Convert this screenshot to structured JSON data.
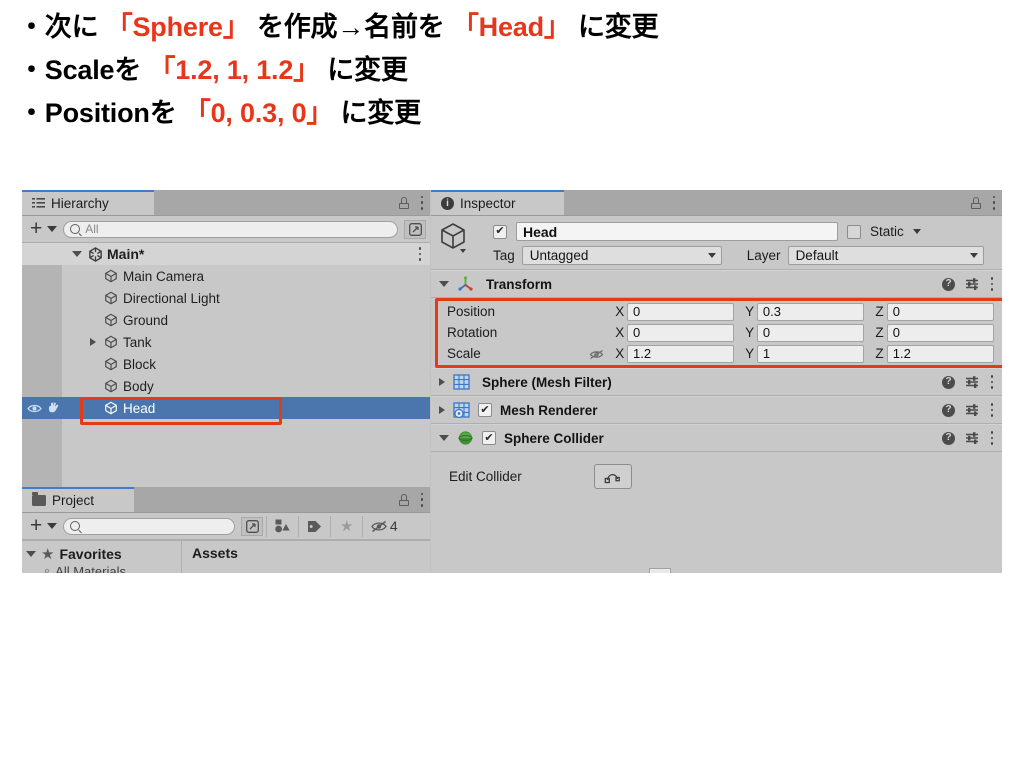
{
  "slide": {
    "bullets": [
      [
        {
          "t": "・次に ",
          "hl": false
        },
        {
          "t": "「Sphere」",
          "hl": true
        },
        {
          "t": " を作成→名前を ",
          "hl": false
        },
        {
          "t": "「Head」",
          "hl": true
        },
        {
          "t": " に変更",
          "hl": false
        }
      ],
      [
        {
          "t": "・Scaleを ",
          "hl": false
        },
        {
          "t": "「1.2, 1, 1.2」",
          "hl": true
        },
        {
          "t": " に変更",
          "hl": false
        }
      ],
      [
        {
          "t": "・Positionを ",
          "hl": false
        },
        {
          "t": "「0, 0.3, 0」",
          "hl": true
        },
        {
          "t": " に変更",
          "hl": false
        }
      ]
    ],
    "highlight_color": "#e8361a",
    "text_color": "#000000"
  },
  "hierarchy": {
    "tab_label": "Hierarchy",
    "tab_icon": "list-icon",
    "add_label": "+",
    "search_placeholder": "All",
    "search_value": "",
    "scene_name": "Main*",
    "items": [
      {
        "label": "Main Camera",
        "depth": 2,
        "expandable": false,
        "selected": false
      },
      {
        "label": "Directional Light",
        "depth": 2,
        "expandable": false,
        "selected": false
      },
      {
        "label": "Ground",
        "depth": 2,
        "expandable": false,
        "selected": false
      },
      {
        "label": "Tank",
        "depth": 2,
        "expandable": true,
        "selected": false
      },
      {
        "label": "Block",
        "depth": 2,
        "expandable": false,
        "selected": false
      },
      {
        "label": "Body",
        "depth": 2,
        "expandable": false,
        "selected": false
      },
      {
        "label": "Head",
        "depth": 2,
        "expandable": false,
        "selected": true
      }
    ],
    "selection_color": "#4a76ad",
    "highlight_box_color": "#e23b15"
  },
  "project": {
    "tab_label": "Project",
    "tab_icon": "folder-icon",
    "add_label": "+",
    "search_placeholder": "",
    "search_value": "",
    "toolbar_icons": [
      "shapes-filter-icon",
      "tag-icon",
      "star-icon",
      "hidden-eye-icon"
    ],
    "hidden_count": "4",
    "favorites_label": "Favorites",
    "favorites_child": "All Materials",
    "assets_label": "Assets"
  },
  "inspector": {
    "tab_label": "Inspector",
    "tab_icon": "info-icon",
    "object_icon": "cube-icon",
    "enabled": true,
    "name_value": "Head",
    "static_label": "Static",
    "static_checked": false,
    "tag_label": "Tag",
    "tag_value": "Untagged",
    "layer_label": "Layer",
    "layer_value": "Default",
    "transform": {
      "title": "Transform",
      "icon": "transform-gizmo-icon",
      "expanded": true,
      "rows": [
        {
          "name": "Position",
          "x": "0",
          "y": "0.3",
          "z": "0",
          "link": false
        },
        {
          "name": "Rotation",
          "x": "0",
          "y": "0",
          "z": "0",
          "link": false
        },
        {
          "name": "Scale",
          "x": "1.2",
          "y": "1",
          "z": "1.2",
          "link": true
        }
      ],
      "axis_labels": [
        "X",
        "Y",
        "Z"
      ],
      "link_icon": "unlinked-scale-icon"
    },
    "components": [
      {
        "title": "Sphere (Mesh Filter)",
        "icon": "mesh-filter-icon",
        "expanded": false,
        "has_checkbox": false,
        "checked": false
      },
      {
        "title": "Mesh Renderer",
        "icon": "mesh-renderer-icon",
        "expanded": false,
        "has_checkbox": true,
        "checked": true
      },
      {
        "title": "Sphere Collider",
        "icon": "sphere-collider-icon",
        "expanded": true,
        "has_checkbox": true,
        "checked": true
      }
    ],
    "edit_collider_label": "Edit Collider",
    "edit_collider_icon": "collider-edit-icon",
    "header_icons": [
      "help-icon",
      "preset-icon",
      "kebab-menu-icon"
    ],
    "highlight_box_color": "#e23b15"
  }
}
